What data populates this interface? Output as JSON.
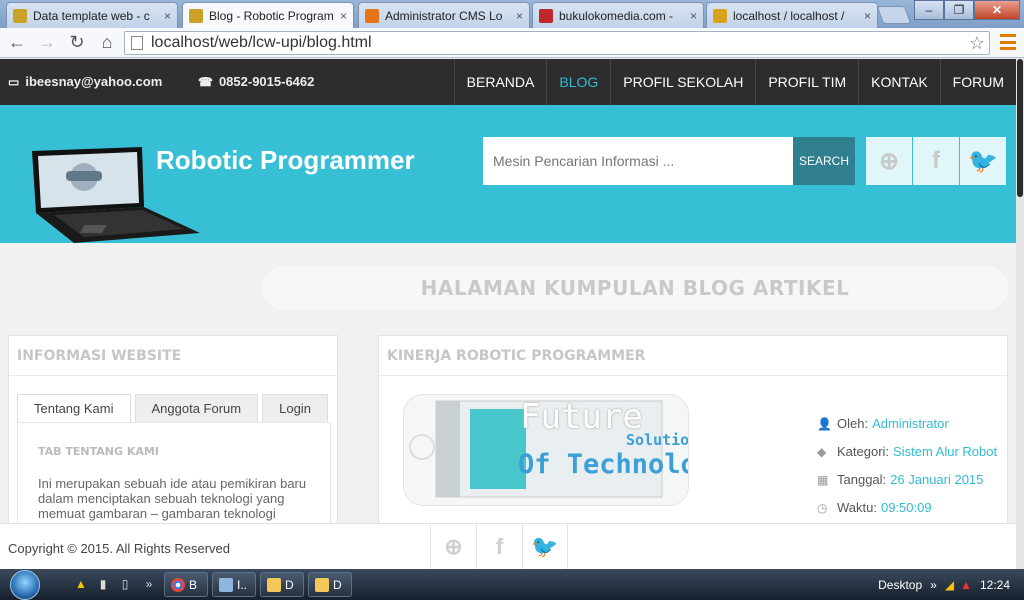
{
  "browser": {
    "tabs": [
      {
        "title": "Data template web - c",
        "favicon_color": "#c9a227"
      },
      {
        "title": "Blog - Robotic Program",
        "favicon_color": "#c9a227",
        "active": true
      },
      {
        "title": "Administrator CMS Lo",
        "favicon_color": "#e8741a"
      },
      {
        "title": "bukulokomedia.com -",
        "favicon_color": "#c0272d"
      },
      {
        "title": "localhost / localhost /",
        "favicon_color": "#d9a21b"
      }
    ],
    "url": "localhost/web/lcw-upi/blog.html"
  },
  "topbar": {
    "email": "ibeesnay@yahoo.com",
    "phone": "0852-9015-6462",
    "nav": [
      "BERANDA",
      "BLOG",
      "PROFIL SEKOLAH",
      "PROFIL TIM",
      "KONTAK",
      "FORUM"
    ],
    "active_nav": "BLOG"
  },
  "hero": {
    "site_title": "Robotic Programmer",
    "search_placeholder": "Mesin Pencarian Informasi ...",
    "search_button": "SEARCH"
  },
  "page": {
    "heading": "HALAMAN KUMPULAN BLOG ARTIKEL"
  },
  "sidebar": {
    "title": "INFORMASI WEBSITE",
    "tabs": [
      "Tentang Kami",
      "Anggota Forum",
      "Login"
    ],
    "tab_title": "TAB TENTANG KAMI",
    "tab_body": "Ini merupakan sebuah ide atau pemikiran baru dalam menciptakan sebuah teknologi yang memuat gambaran – gambaran teknologi masa depan. Dimana pemikiran yang dimuat"
  },
  "article": {
    "title": "KINERJA ROBOTIC PROGRAMMER",
    "image_text_1": "Future",
    "image_text_2": "Solutions",
    "image_text_3": "Of Technology",
    "meta": [
      {
        "icon": "user-icon",
        "label": "Oleh:",
        "value": "Administrator"
      },
      {
        "icon": "tag-icon",
        "label": "Kategori:",
        "value": "Sistem Alur Robot"
      },
      {
        "icon": "calendar-icon",
        "label": "Tanggal:",
        "value": "26 Januari 2015"
      },
      {
        "icon": "clock-icon",
        "label": "Waktu:",
        "value": "09:50:09"
      }
    ]
  },
  "footer": {
    "copyright": "Copyright © 2015. All Rights Reserved"
  },
  "taskbar": {
    "tasks": [
      "B",
      "I..",
      "D",
      "D"
    ],
    "desktop_label": "Desktop",
    "clock": "12:24"
  },
  "colors": {
    "accent": "#37bfd6",
    "topbar": "#2d2d2d",
    "search_button": "#2f7f8e"
  }
}
